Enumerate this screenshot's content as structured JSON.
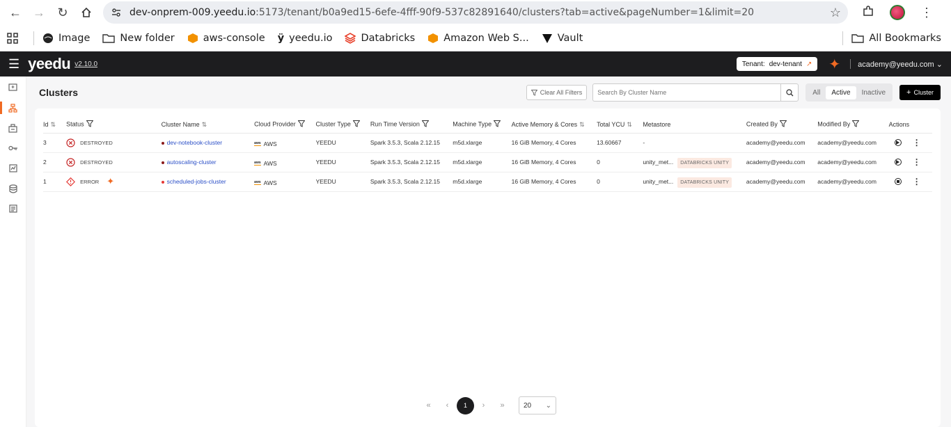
{
  "browser": {
    "url_host": "dev-onprem-009.yeedu.io",
    "url_path": ":5173/tenant/b0a9ed15-6efe-4fff-90f9-537c82891640/clusters?tab=active&pageNumber=1&limit=20"
  },
  "bookmarks": {
    "items": [
      "Image",
      "New folder",
      "aws-console",
      "yeedu.io",
      "Databricks",
      "Amazon Web S...",
      "Vault"
    ],
    "all": "All Bookmarks"
  },
  "header": {
    "logo": "yeedu",
    "version": "v2.10.0",
    "tenant_label": "Tenant:",
    "tenant_name": "dev-tenant",
    "user_email": "academy@yeedu.com"
  },
  "page": {
    "title": "Clusters",
    "clear_filters": "Clear All Filters",
    "search_placeholder": "Search By Cluster Name",
    "tabs": [
      "All",
      "Active",
      "Inactive"
    ],
    "add_button": "Cluster"
  },
  "table": {
    "headers": [
      "Id",
      "Status",
      "Cluster Name",
      "Cloud Provider",
      "Cluster Type",
      "Run Time Version",
      "Machine Type",
      "Active Memory & Cores",
      "Total YCU",
      "Metastore",
      "Created By",
      "Modified By",
      "Actions"
    ],
    "rows": [
      {
        "id": "3",
        "status": "DESTROYED",
        "name": "dev-notebook-cluster",
        "dot": "#8b1a1a",
        "provider": "AWS",
        "type": "YEEDU",
        "runtime": "Spark 3.5.3, Scala 2.12.15",
        "machine": "m5d.xlarge",
        "memory": "16 GiB Memory, 4 Cores",
        "ycu": "13.60667",
        "metastore": "-",
        "badge": "",
        "created_by": "academy@yeedu.com",
        "modified_by": "academy@yeedu.com"
      },
      {
        "id": "2",
        "status": "DESTROYED",
        "name": "autoscaling-cluster",
        "dot": "#8b1a1a",
        "provider": "AWS",
        "type": "YEEDU",
        "runtime": "Spark 3.5.3, Scala 2.12.15",
        "machine": "m5d.xlarge",
        "memory": "16 GiB Memory, 4 Cores",
        "ycu": "0",
        "metastore": "unity_met...",
        "badge": "DATABRICKS UNITY",
        "created_by": "academy@yeedu.com",
        "modified_by": "academy@yeedu.com"
      },
      {
        "id": "1",
        "status": "ERROR",
        "name": "scheduled-jobs-cluster",
        "dot": "#e53935",
        "provider": "AWS",
        "type": "YEEDU",
        "runtime": "Spark 3.5.3, Scala 2.12.15",
        "machine": "m5d.xlarge",
        "memory": "16 GiB Memory, 4 Cores",
        "ycu": "0",
        "metastore": "unity_met...",
        "badge": "DATABRICKS UNITY",
        "created_by": "academy@yeedu.com",
        "modified_by": "academy@yeedu.com"
      }
    ]
  },
  "pagination": {
    "current": "1",
    "page_size": "20"
  },
  "colors": {
    "accent": "#f06a23",
    "header_bg": "#1d1d1f",
    "link": "#2b4fc7",
    "error": "#e53935"
  }
}
